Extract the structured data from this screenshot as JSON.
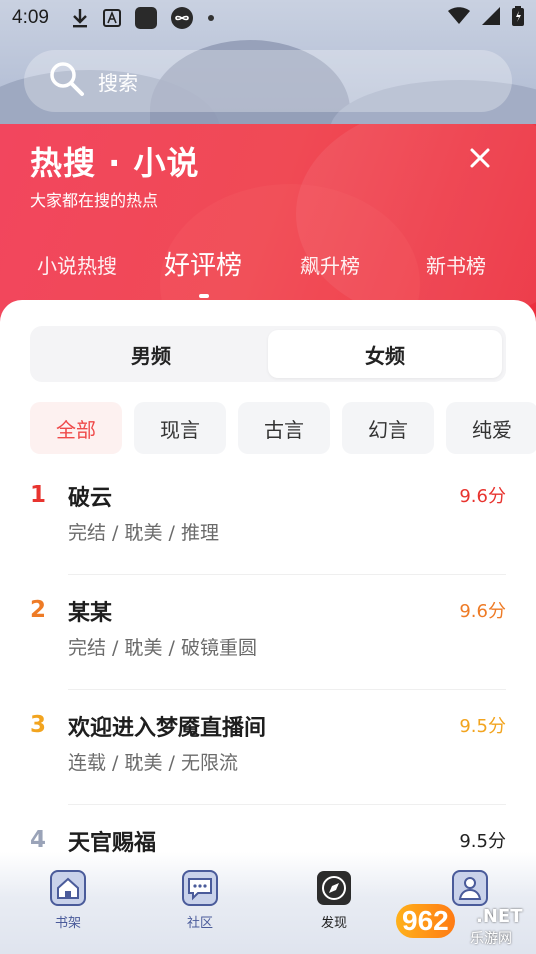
{
  "status_bar": {
    "time": "4:09"
  },
  "search": {
    "placeholder": "搜索"
  },
  "hot": {
    "title": "热搜 · 小说",
    "subtitle": "大家都在搜的热点",
    "tabs": [
      {
        "label": "小说热搜"
      },
      {
        "label": "好评榜"
      },
      {
        "label": "飙升榜"
      },
      {
        "label": "新书榜"
      }
    ],
    "active_tab": "好评榜"
  },
  "segment": {
    "items": [
      "男频",
      "女频"
    ],
    "selected": "女频"
  },
  "filters": {
    "items": [
      "全部",
      "现言",
      "古言",
      "幻言",
      "纯爱"
    ],
    "selected": "全部"
  },
  "books": [
    {
      "rank": "1",
      "title": "破云",
      "meta": "完结 / 耽美 / 推理",
      "score": "9.6分",
      "color": "#e8342f"
    },
    {
      "rank": "2",
      "title": "某某",
      "meta": "完结 / 耽美 / 破镜重圆",
      "score": "9.6分",
      "color": "#ee7b26"
    },
    {
      "rank": "3",
      "title": "欢迎进入梦魇直播间",
      "meta": "连载 / 耽美 / 无限流",
      "score": "9.5分",
      "color": "#f2a41f"
    },
    {
      "rank": "4",
      "title": "天官赐福",
      "meta": "",
      "score": "9.5分",
      "color": "#9aa3b8"
    }
  ],
  "bottom_nav": [
    {
      "label": "书架",
      "icon": "house-icon"
    },
    {
      "label": "社区",
      "icon": "chat-bubble-icon"
    },
    {
      "label": "发现",
      "icon": "compass-icon"
    },
    {
      "label": "",
      "icon": "user-icon"
    }
  ],
  "watermark": {
    "number": "962",
    "suffix": ".NET",
    "site": "乐游网"
  },
  "colors": {
    "accent": "#ef4a4a",
    "hot_panel": "#f04a55"
  }
}
